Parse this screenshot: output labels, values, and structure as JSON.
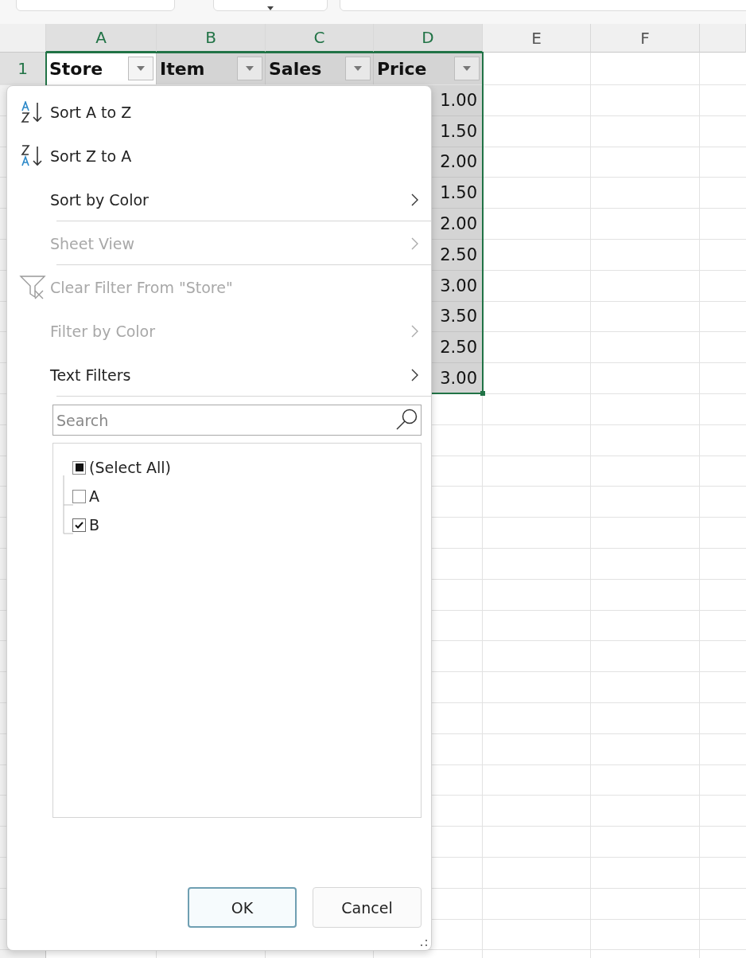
{
  "columns": [
    {
      "label": "A",
      "selected": true
    },
    {
      "label": "B",
      "selected": true
    },
    {
      "label": "C",
      "selected": true
    },
    {
      "label": "D",
      "selected": true
    },
    {
      "label": "E",
      "selected": false
    },
    {
      "label": "F",
      "selected": false
    }
  ],
  "row_headers": [
    {
      "label": "1",
      "selected": true
    }
  ],
  "header_cells": [
    {
      "text": "Store",
      "active": true
    },
    {
      "text": "Item",
      "active": false
    },
    {
      "text": "Sales",
      "active": false
    },
    {
      "text": "Price",
      "active": false
    }
  ],
  "price_values": [
    "1.00",
    "1.50",
    "2.00",
    "1.50",
    "2.00",
    "2.50",
    "3.00",
    "3.50",
    "2.50",
    "3.00"
  ],
  "filter_menu": {
    "items": [
      {
        "kind": "sort-asc",
        "label": "Sort A to Z",
        "disabled": false,
        "submenu": false,
        "separator_after": false
      },
      {
        "kind": "sort-desc",
        "label": "Sort Z to A",
        "disabled": false,
        "submenu": false,
        "separator_after": false
      },
      {
        "kind": "plain",
        "label": "Sort by Color",
        "disabled": false,
        "submenu": true,
        "separator_after": true
      },
      {
        "kind": "plain",
        "label": "Sheet View",
        "disabled": true,
        "submenu": true,
        "separator_after": true
      },
      {
        "kind": "clear-filter",
        "label": "Clear Filter From \"Store\"",
        "disabled": true,
        "submenu": false,
        "separator_after": false
      },
      {
        "kind": "plain",
        "label": "Filter by Color",
        "disabled": true,
        "submenu": true,
        "separator_after": false
      },
      {
        "kind": "plain",
        "label": "Text Filters",
        "disabled": false,
        "submenu": true,
        "separator_after": true
      }
    ],
    "search": {
      "placeholder": "Search"
    },
    "checklist": [
      {
        "label": "(Select All)",
        "checked": false,
        "partial": true
      },
      {
        "label": "A",
        "checked": false,
        "partial": false
      },
      {
        "label": "B",
        "checked": true,
        "partial": false
      }
    ],
    "buttons": [
      {
        "label": "OK",
        "default": true
      },
      {
        "label": "Cancel",
        "default": false
      }
    ]
  }
}
